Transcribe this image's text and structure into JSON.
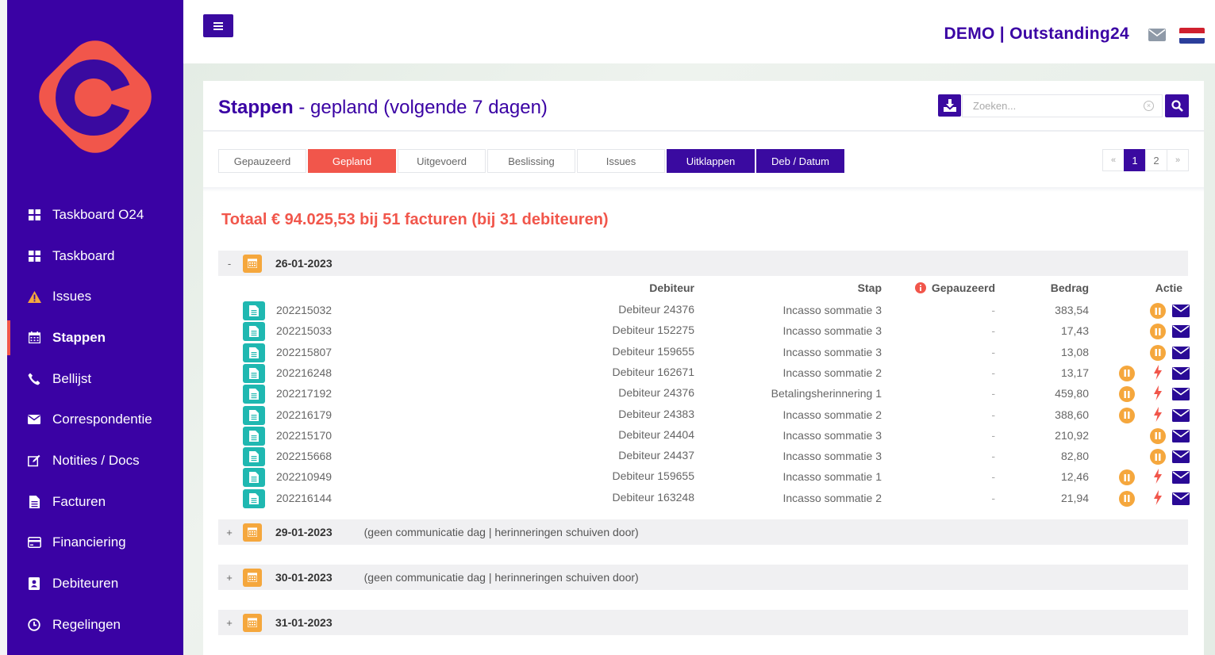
{
  "brand": "DEMO | Outstanding24",
  "colors": {
    "primary": "#3a02a4",
    "accent": "#f1564b",
    "orange": "#f5a73d",
    "teal": "#1fb8b1"
  },
  "sidebar": {
    "items": [
      {
        "label": "Taskboard O24",
        "icon": "grid-icon"
      },
      {
        "label": "Taskboard",
        "icon": "grid-icon"
      },
      {
        "label": "Issues",
        "icon": "warning-icon"
      },
      {
        "label": "Stappen",
        "icon": "calendar-icon"
      },
      {
        "label": "Bellijst",
        "icon": "phone-icon"
      },
      {
        "label": "Correspondentie",
        "icon": "mail-icon"
      },
      {
        "label": "Notities / Docs",
        "icon": "edit-icon"
      },
      {
        "label": "Facturen",
        "icon": "file-icon"
      },
      {
        "label": "Financiering",
        "icon": "credit-card-icon"
      },
      {
        "label": "Debiteuren",
        "icon": "contact-book-icon"
      },
      {
        "label": "Regelingen",
        "icon": "clock-icon"
      }
    ]
  },
  "page": {
    "title_bold": "Stappen",
    "title_rest": " - gepland (volgende 7 dagen)",
    "search_placeholder": "Zoeken..."
  },
  "tabs": [
    "Gepauzeerd",
    "Gepland",
    "Uitgevoerd",
    "Beslissing",
    "Issues",
    "Uitklappen",
    "Deb / Datum"
  ],
  "pager": {
    "prev": "«",
    "pages": [
      "1",
      "2"
    ],
    "next": "»"
  },
  "total": "Totaal € 94.025,53 bij 51 facturen (bij 31 debiteuren)",
  "columns": {
    "debiteur": "Debiteur",
    "stap": "Stap",
    "gepauzeerd": "Gepauzeerd",
    "bedrag": "Bedrag",
    "actie": "Actie"
  },
  "groups": [
    {
      "toggle": "-",
      "date": "26-01-2023",
      "note": ""
    },
    {
      "toggle": "+",
      "date": "29-01-2023",
      "note": "(geen communicatie dag | herinneringen schuiven door)"
    },
    {
      "toggle": "+",
      "date": "30-01-2023",
      "note": "(geen communicatie dag | herinneringen schuiven door)"
    },
    {
      "toggle": "+",
      "date": "31-01-2023",
      "note": ""
    }
  ],
  "rows": [
    {
      "invoice": "202215032",
      "debiteur": "Debiteur 24376",
      "stap": "Incasso sommatie 3",
      "gepauzeerd": "-",
      "bedrag": "383,54",
      "bolt": false
    },
    {
      "invoice": "202215033",
      "debiteur": "Debiteur 152275",
      "stap": "Incasso sommatie 3",
      "gepauzeerd": "-",
      "bedrag": "17,43",
      "bolt": false
    },
    {
      "invoice": "202215807",
      "debiteur": "Debiteur 159655",
      "stap": "Incasso sommatie 3",
      "gepauzeerd": "-",
      "bedrag": "13,08",
      "bolt": false
    },
    {
      "invoice": "202216248",
      "debiteur": "Debiteur 162671",
      "stap": "Incasso sommatie 2",
      "gepauzeerd": "-",
      "bedrag": "13,17",
      "bolt": true
    },
    {
      "invoice": "202217192",
      "debiteur": "Debiteur 24376",
      "stap": "Betalingsherinnering 1",
      "gepauzeerd": "-",
      "bedrag": "459,80",
      "bolt": true
    },
    {
      "invoice": "202216179",
      "debiteur": "Debiteur 24383",
      "stap": "Incasso sommatie 2",
      "gepauzeerd": "-",
      "bedrag": "388,60",
      "bolt": true
    },
    {
      "invoice": "202215170",
      "debiteur": "Debiteur 24404",
      "stap": "Incasso sommatie 3",
      "gepauzeerd": "-",
      "bedrag": "210,92",
      "bolt": false
    },
    {
      "invoice": "202215668",
      "debiteur": "Debiteur 24437",
      "stap": "Incasso sommatie 3",
      "gepauzeerd": "-",
      "bedrag": "82,80",
      "bolt": false
    },
    {
      "invoice": "202210949",
      "debiteur": "Debiteur 159655",
      "stap": "Incasso sommatie 1",
      "gepauzeerd": "-",
      "bedrag": "12,46",
      "bolt": true
    },
    {
      "invoice": "202216144",
      "debiteur": "Debiteur 163248",
      "stap": "Incasso sommatie 2",
      "gepauzeerd": "-",
      "bedrag": "21,94",
      "bolt": true
    }
  ]
}
